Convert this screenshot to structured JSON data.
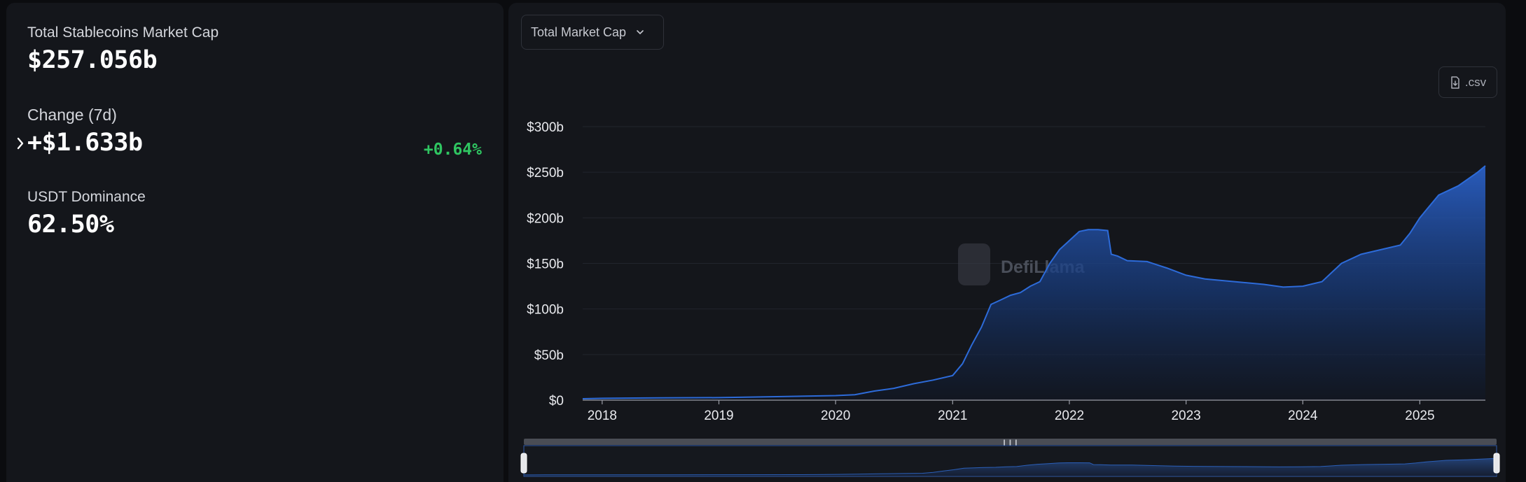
{
  "stats": {
    "market_cap_label": "Total Stablecoins Market Cap",
    "market_cap_value": "$257.056b",
    "change_label": "Change (7d)",
    "change_value": "+$1.633b",
    "change_percent": "+0.64%",
    "dominance_label": "USDT Dominance",
    "dominance_value": "62.50%"
  },
  "controls": {
    "metric_selector": "Total Market Cap",
    "csv_label": ".csv"
  },
  "watermark": "DefiLlama",
  "colors": {
    "accent": "#2d6bd9",
    "positive": "#2fc561",
    "panel": "#14161b",
    "background": "#0b0c0f"
  },
  "chart_data": {
    "type": "area",
    "series": [
      {
        "x": [
          "2017-11-01",
          "2018-01-01",
          "2018-07-01",
          "2019-01-01",
          "2019-07-01",
          "2020-01-01",
          "2020-03-01",
          "2020-05-01",
          "2020-07-01",
          "2020-09-01",
          "2020-11-01",
          "2021-01-01",
          "2021-02-01",
          "2021-03-01",
          "2021-04-01",
          "2021-05-01",
          "2021-06-01",
          "2021-07-01",
          "2021-08-01",
          "2021-09-01",
          "2021-10-01",
          "2021-11-01",
          "2021-12-01",
          "2022-01-01",
          "2022-02-01",
          "2022-03-01",
          "2022-04-01",
          "2022-05-01",
          "2022-05-12",
          "2022-06-01",
          "2022-07-01",
          "2022-09-01",
          "2022-11-01",
          "2023-01-01",
          "2023-03-01",
          "2023-06-01",
          "2023-09-01",
          "2023-11-01",
          "2024-01-01",
          "2024-03-01",
          "2024-05-01",
          "2024-07-01",
          "2024-09-01",
          "2024-11-01",
          "2024-12-01",
          "2025-01-01",
          "2025-03-01",
          "2025-05-01",
          "2025-07-01",
          "2025-07-25"
        ],
        "values": [
          1.5,
          2,
          2.5,
          2.8,
          3.8,
          5,
          6,
          10,
          13,
          18,
          22,
          27,
          40,
          60,
          80,
          105,
          110,
          115,
          118,
          125,
          130,
          150,
          165,
          175,
          185,
          187,
          187,
          186,
          160,
          158,
          153,
          152,
          145,
          137,
          133,
          130,
          127,
          124,
          125,
          130,
          150,
          160,
          165,
          170,
          183,
          200,
          225,
          235,
          250,
          257
        ]
      }
    ],
    "xlabel": "",
    "ylabel": "",
    "y_ticks": [
      "$0",
      "$50b",
      "$100b",
      "$150b",
      "$200b",
      "$250b",
      "$300b"
    ],
    "x_ticks": [
      "2018",
      "2019",
      "2020",
      "2021",
      "2022",
      "2023",
      "2024",
      "2025"
    ],
    "ylim": [
      0,
      300
    ],
    "xlim": [
      "2017-11-01",
      "2025-07-25"
    ],
    "grid": true,
    "legend": "none"
  }
}
